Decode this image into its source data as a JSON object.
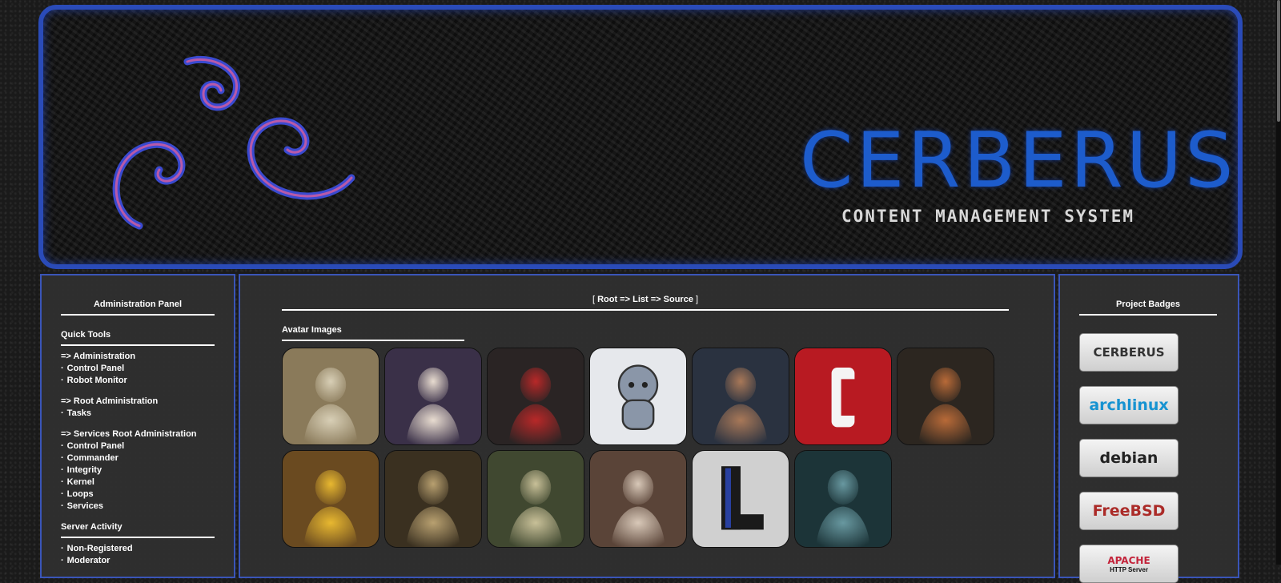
{
  "banner": {
    "title": "CERBERUS",
    "subtitle": "CONTENT MANAGEMENT SYSTEM"
  },
  "left_panel": {
    "title": "Administration Panel",
    "quick_tools_title": "Quick Tools",
    "groups": [
      {
        "head": "=> Administration",
        "items": [
          "Control Panel",
          "Robot Monitor"
        ]
      },
      {
        "head": "=> Root Administration",
        "items": [
          "Tasks"
        ]
      },
      {
        "head": "=> Services Root Administration",
        "items": [
          "Control Panel",
          "Commander",
          "Integrity",
          "Kernel",
          "Loops",
          "Services"
        ]
      }
    ],
    "server_activity_title": "Server Activity",
    "server_activity_items": [
      "Non-Registered",
      "Moderator"
    ]
  },
  "main": {
    "breadcrumb": {
      "open": "[",
      "root": "Root",
      "sep1": "=>",
      "list": "List",
      "sep2": "=>",
      "source": "Source",
      "close": "]"
    },
    "avatar_heading": "Avatar Images",
    "avatars": [
      {
        "name": "archer-goddess-avatar",
        "bg": "#8a7a5a",
        "fg": "#d8cfb6"
      },
      {
        "name": "flower-maiden-avatar",
        "bg": "#3a3048",
        "fg": "#e8dcd0"
      },
      {
        "name": "red-demon-avatar",
        "bg": "#2a2424",
        "fg": "#b82828"
      },
      {
        "name": "cerberus-mascot-avatar",
        "bg": "#e6e8ec",
        "fg": "#8a96a8"
      },
      {
        "name": "winged-warrior-avatar",
        "bg": "#2a3240",
        "fg": "#a87858"
      },
      {
        "name": "red-c-logo-avatar",
        "bg": "#b81a22",
        "fg": "#f4f4f4"
      },
      {
        "name": "flower-witch-avatar",
        "bg": "#2c2620",
        "fg": "#b86a38"
      },
      {
        "name": "sun-warrior-avatar",
        "bg": "#6a4a20",
        "fg": "#e8b830"
      },
      {
        "name": "seated-goddess-avatar",
        "bg": "#3a3020",
        "fg": "#b8a070"
      },
      {
        "name": "forest-nymph-avatar",
        "bg": "#404830",
        "fg": "#c8c098"
      },
      {
        "name": "zeus-avatar",
        "bg": "#5a4438",
        "fg": "#d8c8b8"
      },
      {
        "name": "blue-l-logo-avatar",
        "bg": "#d0d0d0",
        "fg": "#2840a0"
      },
      {
        "name": "poseidon-avatar",
        "bg": "#1c3438",
        "fg": "#6898a0"
      }
    ]
  },
  "right_panel": {
    "title": "Project Badges",
    "badges": [
      {
        "name": "cerberus-badge",
        "label": "CERBERUS",
        "color": "#333333"
      },
      {
        "name": "archlinux-badge",
        "label": "archlinux",
        "color": "#1793d1"
      },
      {
        "name": "debian-badge",
        "label": "debian",
        "color": "#222222"
      },
      {
        "name": "freebsd-badge",
        "label": "FreeBSD",
        "color": "#ab2b28"
      },
      {
        "name": "apache-badge",
        "label": "APACHE",
        "sublabel": "HTTP Server",
        "color": "#c3233a"
      }
    ]
  }
}
